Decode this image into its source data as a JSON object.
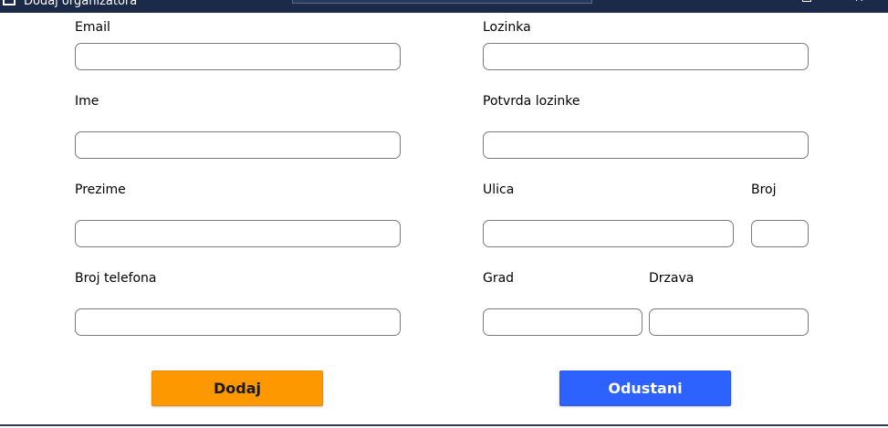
{
  "window": {
    "title": "Dodaj organizatora",
    "close_glyph": "✕"
  },
  "form": {
    "email": {
      "label": "Email",
      "value": ""
    },
    "ime": {
      "label": "Ime",
      "value": ""
    },
    "prezime": {
      "label": "Prezime",
      "value": ""
    },
    "broj_telefona": {
      "label": "Broj telefona",
      "value": ""
    },
    "lozinka": {
      "label": "Lozinka",
      "value": ""
    },
    "potvrda_lozinke": {
      "label": "Potvrda lozinke",
      "value": ""
    },
    "ulica": {
      "label": "Ulica",
      "value": ""
    },
    "broj": {
      "label": "Broj",
      "value": ""
    },
    "grad": {
      "label": "Grad",
      "value": ""
    },
    "drzava": {
      "label": "Drzava",
      "value": ""
    }
  },
  "actions": {
    "add_label": "Dodaj",
    "cancel_label": "Odustani"
  },
  "colors": {
    "titlebar": "#1c2a4a",
    "add_button": "#fd9801",
    "cancel_button": "#2d62fe"
  }
}
